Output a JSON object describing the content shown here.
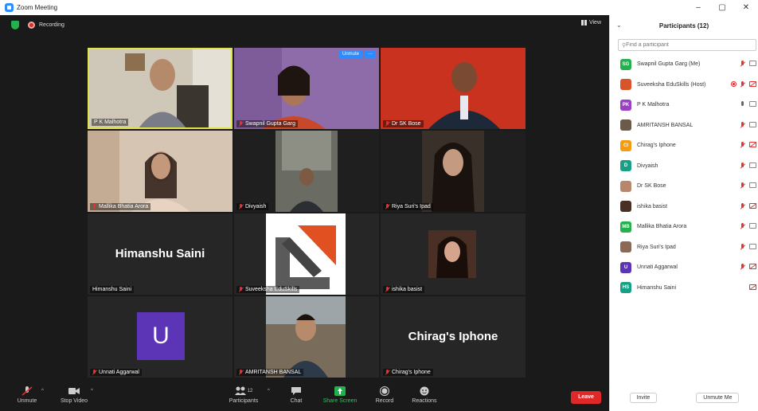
{
  "window": {
    "title": "Zoom Meeting",
    "controls": [
      "–",
      "▢",
      "✕"
    ]
  },
  "meeting": {
    "recording_label": "Recording",
    "view_label": "View"
  },
  "tiles": [
    {
      "name": "P K Malhotra",
      "muted": false,
      "type": "video",
      "bg": "#cfc8b8"
    },
    {
      "name": "Swapnil Gupta Garg",
      "muted": true,
      "type": "video",
      "bg": "#8e6ba9",
      "unmute_label": "Unmute",
      "more_label": "···"
    },
    {
      "name": "Dr SK Bose",
      "muted": true,
      "type": "video",
      "bg": "#c8321e"
    },
    {
      "name": "Mallika Bhatia Arora",
      "muted": true,
      "type": "video",
      "bg": "#d6c5b3"
    },
    {
      "name": "Divyaish",
      "muted": true,
      "type": "video",
      "bg": "#5a5c55"
    },
    {
      "name": "Riya Suri's Ipad",
      "muted": true,
      "type": "video",
      "bg": "#3a302a"
    },
    {
      "name": "Himanshu Saini",
      "muted": false,
      "type": "name",
      "display": "Himanshu Saini"
    },
    {
      "name": "Suveeksha EduSkills",
      "muted": true,
      "type": "logo"
    },
    {
      "name": "ishika basist",
      "muted": true,
      "type": "photo"
    },
    {
      "name": "Unnati Aggarwal",
      "muted": true,
      "type": "avatar",
      "initial": "U"
    },
    {
      "name": "AMRITANSH BANSAL",
      "muted": true,
      "type": "photo2"
    },
    {
      "name": "Chirag's Iphone",
      "muted": true,
      "type": "name",
      "display": "Chirag's Iphone"
    }
  ],
  "toolbar": {
    "unmute": "Unmute",
    "stop_video": "Stop Video",
    "participants": "Participants",
    "participants_count": "12",
    "chat": "Chat",
    "share_screen": "Share Screen",
    "record": "Record",
    "reactions": "Reactions",
    "leave": "Leave"
  },
  "panel": {
    "title": "Participants (12)",
    "search_placeholder": "Find a participant",
    "participants": [
      {
        "initials": "SG",
        "name": "Swapnil Gupta Garg (Me)",
        "color": "#22b14c",
        "mic": "off",
        "cam": "on"
      },
      {
        "initials": "",
        "name": "Suveeksha EduSkills (Host)",
        "color": "#d9542b",
        "mic": "off",
        "cam": "off",
        "rec": true
      },
      {
        "initials": "PK",
        "name": "P K Malhotra",
        "color": "#9b3fc4",
        "mic": "on",
        "cam": "on"
      },
      {
        "initials": "",
        "name": "AMRITANSH BANSAL",
        "color": "#6b5a48",
        "mic": "off",
        "cam": "on"
      },
      {
        "initials": "CI",
        "name": "Chirag's Iphone",
        "color": "#f39c12",
        "mic": "off",
        "cam": "off"
      },
      {
        "initials": "D",
        "name": "Divyaish",
        "color": "#16a085",
        "mic": "off",
        "cam": "on"
      },
      {
        "initials": "",
        "name": "Dr SK Bose",
        "color": "#b8866b",
        "mic": "off",
        "cam": "on"
      },
      {
        "initials": "",
        "name": "ishika basist",
        "color": "#4a2f25",
        "mic": "off",
        "cam": "off"
      },
      {
        "initials": "MB",
        "name": "Mallika Bhatia Arora",
        "color": "#22b14c",
        "mic": "off",
        "cam": "on"
      },
      {
        "initials": "",
        "name": "Riya Suri's Ipad",
        "color": "#8a6a55",
        "mic": "off",
        "cam": "on"
      },
      {
        "initials": "U",
        "name": "Unnati Aggarwal",
        "color": "#5b35b6",
        "mic": "off",
        "cam": "off"
      },
      {
        "initials": "HS",
        "name": "Himanshu Saini",
        "color": "#16a085",
        "mic": "none",
        "cam": "off"
      }
    ],
    "invite": "Invite",
    "unmute_me": "Unmute Me"
  }
}
